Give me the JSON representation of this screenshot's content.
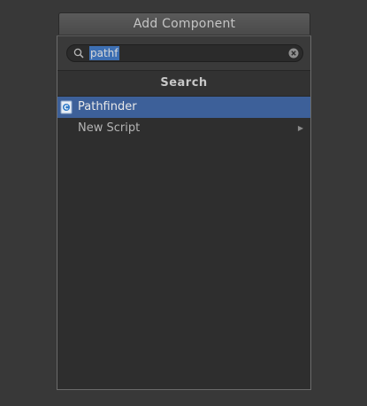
{
  "add_component_button": {
    "label": "Add Component"
  },
  "search": {
    "query": "pathf"
  },
  "results_header": {
    "title": "Search"
  },
  "items": [
    {
      "label": "Pathfinder",
      "icon": "csharp-script-icon",
      "selected": true
    },
    {
      "label": "New Script",
      "icon": "submenu-arrow-icon",
      "selected": false
    }
  ],
  "colors": {
    "selection": "#3d6099",
    "text_highlight": "#3d6fb3",
    "background": "#383838"
  }
}
